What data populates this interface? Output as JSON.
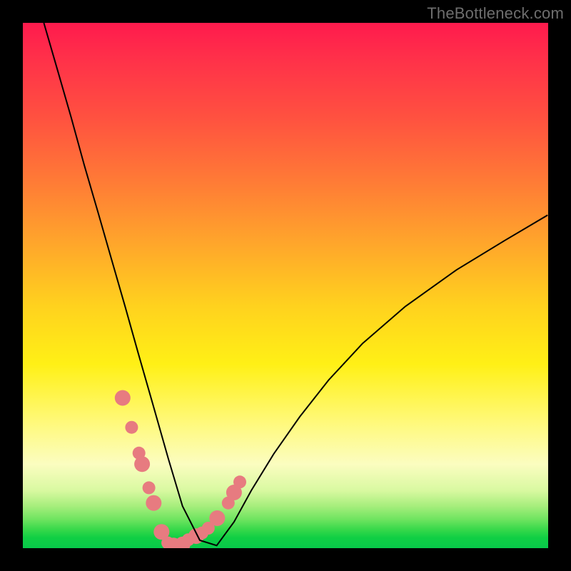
{
  "watermark": "TheBottleneck.com",
  "colors": {
    "dot": "#e77b80",
    "curve": "#000000",
    "frame": "#000000"
  },
  "chart_data": {
    "type": "line",
    "title": "",
    "xlabel": "",
    "ylabel": "",
    "xlim": [
      0,
      100
    ],
    "ylim": [
      0,
      100
    ],
    "note": "Axes have no visible tick labels; values are percentages of the plotting area width/height estimated from pixel positions.",
    "series": [
      {
        "name": "bottleneck-curve",
        "x": [
          4.0,
          6.6,
          9.2,
          11.7,
          14.3,
          16.9,
          19.5,
          22.0,
          24.6,
          27.7,
          30.4,
          33.7,
          36.9,
          40.2,
          43.5,
          47.8,
          52.7,
          58.2,
          64.7,
          72.8,
          82.6,
          91.8,
          99.9
        ],
        "y": [
          100.0,
          91.0,
          82.0,
          72.9,
          64.0,
          54.9,
          45.9,
          37.0,
          27.9,
          17.0,
          8.0,
          1.5,
          0.5,
          5.0,
          11.0,
          18.0,
          25.0,
          32.0,
          39.0,
          46.0,
          53.0,
          58.6,
          63.4
        ],
        "description": "V-shaped curve; y is approximate bottleneck % (0 at minimum around x≈23–25)."
      }
    ],
    "points": {
      "name": "highlighted-points",
      "description": "Pink circular markers clustered near the bottom of the V.",
      "x": [
        19.0,
        20.7,
        22.1,
        22.7,
        24.0,
        24.9,
        26.4,
        27.6,
        28.7,
        30.4,
        31.5,
        33.0,
        34.1,
        35.3,
        37.0,
        39.1,
        40.2,
        41.3
      ],
      "y": [
        28.6,
        23.0,
        18.1,
        16.0,
        11.5,
        8.6,
        3.1,
        1.0,
        0.5,
        0.7,
        1.6,
        2.3,
        2.9,
        3.8,
        5.7,
        8.6,
        10.6,
        12.6
      ],
      "r": [
        11,
        9,
        9,
        11,
        9,
        11,
        11,
        9,
        11,
        11,
        9,
        11,
        9,
        9,
        11,
        9,
        11,
        9
      ]
    }
  }
}
